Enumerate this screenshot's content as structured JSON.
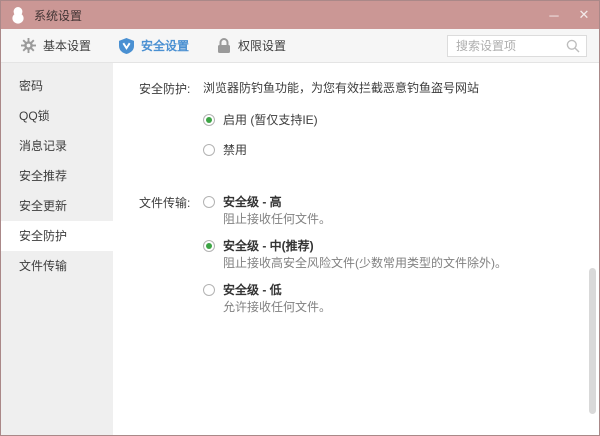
{
  "window": {
    "title": "系统设置",
    "minimize_glyph": "─",
    "close_glyph": "✕"
  },
  "tabs": [
    {
      "label": "基本设置",
      "icon": "gear-icon",
      "active": false
    },
    {
      "label": "安全设置",
      "icon": "shield-icon",
      "active": true
    },
    {
      "label": "权限设置",
      "icon": "lock-icon",
      "active": false
    }
  ],
  "search": {
    "placeholder": "搜索设置项",
    "icon": "search-icon"
  },
  "sidebar": {
    "items": [
      {
        "label": "密码",
        "selected": false
      },
      {
        "label": "QQ锁",
        "selected": false
      },
      {
        "label": "消息记录",
        "selected": false
      },
      {
        "label": "安全推荐",
        "selected": false
      },
      {
        "label": "安全更新",
        "selected": false
      },
      {
        "label": "安全防护",
        "selected": true
      },
      {
        "label": "文件传输",
        "selected": false
      }
    ]
  },
  "content": {
    "sections": [
      {
        "label": "安全防护:",
        "description": "浏览器防钓鱼功能，为您有效拦截恶意钓鱼盗号网站",
        "options": [
          {
            "label": "启用  (暂仅支持IE)",
            "selected": true
          },
          {
            "label": "禁用",
            "selected": false
          }
        ]
      },
      {
        "label": "文件传输:",
        "options": [
          {
            "label": "安全级 - 高",
            "description": "阻止接收任何文件。",
            "selected": false
          },
          {
            "label": "安全级 - 中(推荐)",
            "description": "阻止接收高安全风险文件(少数常用类型的文件除外)。",
            "selected": true
          },
          {
            "label": "安全级 - 低",
            "description": "允许接收任何文件。",
            "selected": false
          }
        ]
      }
    ]
  },
  "colors": {
    "titlebar": "#cb9795",
    "accent_blue": "#4a90d2",
    "radio_green": "#3da445",
    "sidebar_bg": "#efefef",
    "tabbar_bg": "#f6f6f6"
  }
}
